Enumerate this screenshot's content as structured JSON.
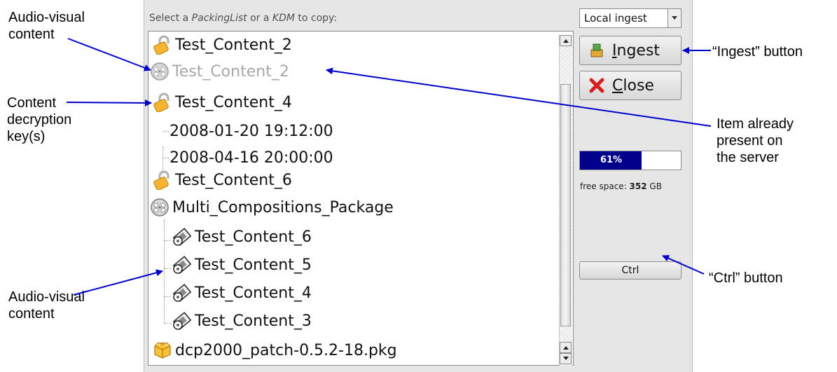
{
  "prompt": {
    "pre": "Select a ",
    "em1": "PackingList",
    "mid": " or a ",
    "em2": "KDM",
    "post": " to copy:"
  },
  "dropdown": {
    "value": "Local ingest"
  },
  "list": [
    {
      "label": "Test_Content_2",
      "icon": "lock-icon",
      "disabled": false
    },
    {
      "label": "Test_Content_2",
      "icon": "film-reel-icon",
      "disabled": true
    },
    {
      "label": "Test_Content_4",
      "icon": "lock-icon",
      "disabled": false
    },
    {
      "label": "2008-01-20 19:12:00",
      "icon": "",
      "disabled": false
    },
    {
      "label": "2008-04-16 20:00:00",
      "icon": "",
      "disabled": false
    },
    {
      "label": "Test_Content_6",
      "icon": "lock-icon",
      "disabled": false
    },
    {
      "label": "Multi_Compositions_Package",
      "icon": "film-reel-icon",
      "disabled": false
    },
    {
      "label": "Test_Content_6",
      "icon": "film-strip-icon",
      "disabled": false
    },
    {
      "label": "Test_Content_5",
      "icon": "film-strip-icon",
      "disabled": false
    },
    {
      "label": "Test_Content_4",
      "icon": "film-strip-icon",
      "disabled": false
    },
    {
      "label": "Test_Content_3",
      "icon": "film-strip-icon",
      "disabled": false
    },
    {
      "label": "dcp2000_patch-0.5.2-18.pkg",
      "icon": "package-icon",
      "disabled": false
    }
  ],
  "buttons": {
    "ingest_pre": "",
    "ingest_u": "I",
    "ingest_post": "ngest",
    "close_u": "C",
    "close_post": "lose",
    "ctrl": "Ctrl"
  },
  "progress": {
    "percent_value": 61,
    "label": "61%"
  },
  "free_space": {
    "prefix": "free space: ",
    "value": "352",
    "unit": " GB"
  },
  "annotations": {
    "av_top": [
      "Audio-visual",
      "content"
    ],
    "cdk": [
      "Content",
      "decryption",
      "key(s)"
    ],
    "av_bottom": [
      "Audio-visual",
      "content"
    ],
    "ingest": "“Ingest” button",
    "present": [
      "Item already",
      "present on",
      "the server"
    ],
    "ctrl": "“Ctrl” button"
  },
  "colors": {
    "accent_arrow": "#0000cc",
    "progress_fill": "#00008a",
    "panel_bg": "#e6e6e6"
  }
}
